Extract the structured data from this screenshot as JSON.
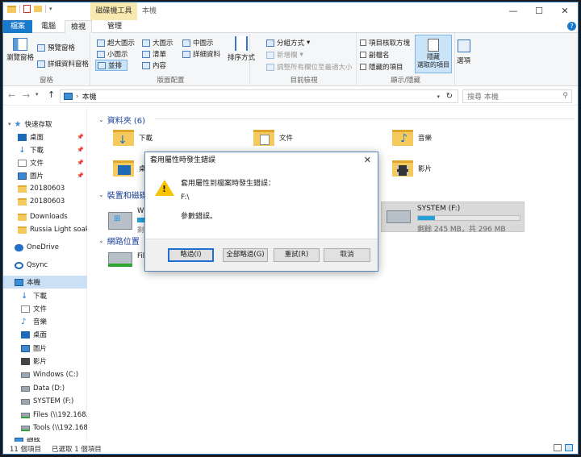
{
  "window": {
    "title": "本機",
    "context_tab_label": "磁碟機工具",
    "controls": {
      "minimize": "—",
      "maximize": "☐",
      "close": "✕"
    }
  },
  "tabs": {
    "file": "檔案",
    "computer": "電腦",
    "view": "檢視",
    "manage": "管理"
  },
  "ribbon": {
    "panes": {
      "nav_pane": "瀏覽窗格",
      "preview_pane": "預覽窗格",
      "details_pane": "詳細資料窗格",
      "label": "窗格"
    },
    "layout": {
      "xl_icons": "超大圖示",
      "large_icons": "大圖示",
      "medium_icons": "中圖示",
      "small_icons": "小圖示",
      "list": "清單",
      "details": "詳細資料",
      "tiles": "並排",
      "content": "內容",
      "label": "版面配置"
    },
    "current_view": {
      "sort_by": "排序方式",
      "group_by": "分組方式",
      "add_columns": "新增欄",
      "size_all_columns": "調整所有欄位至最適大小",
      "label": "目前檢視"
    },
    "show_hide": {
      "item_checkboxes": "項目核取方塊",
      "file_extensions": "副檔名",
      "hidden_items": "隱藏的項目",
      "hide_selected": "隱藏\n選取的項目",
      "label": "顯示/隱藏"
    },
    "options": "選項"
  },
  "address": {
    "path": "本機",
    "search_placeholder": "搜尋 本機"
  },
  "sidebar": {
    "items": [
      {
        "label": "快速存取",
        "icon": "star-icon"
      },
      {
        "label": "桌面",
        "icon": "desktop-icon",
        "pinned": true
      },
      {
        "label": "下載",
        "icon": "download-icon",
        "pinned": true
      },
      {
        "label": "文件",
        "icon": "document-icon",
        "pinned": true
      },
      {
        "label": "圖片",
        "icon": "picture-icon",
        "pinned": true
      },
      {
        "label": "20180603",
        "icon": "folder-icon"
      },
      {
        "label": "20180603",
        "icon": "folder-icon"
      },
      {
        "label": "Downloads",
        "icon": "folder-icon"
      },
      {
        "label": "Russia Light soaki",
        "icon": "folder-icon"
      },
      {
        "label": "OneDrive",
        "icon": "cloud-icon"
      },
      {
        "label": "Qsync",
        "icon": "qsync-icon"
      },
      {
        "label": "本機",
        "icon": "pc-icon"
      },
      {
        "label": "下載",
        "icon": "download-icon"
      },
      {
        "label": "文件",
        "icon": "document-icon"
      },
      {
        "label": "音樂",
        "icon": "music-icon"
      },
      {
        "label": "桌面",
        "icon": "desktop-icon"
      },
      {
        "label": "圖片",
        "icon": "picture-icon"
      },
      {
        "label": "影片",
        "icon": "video-icon"
      },
      {
        "label": "Windows (C:)",
        "icon": "drive-icon"
      },
      {
        "label": "Data (D:)",
        "icon": "drive-icon"
      },
      {
        "label": "SYSTEM (F:)",
        "icon": "drive-icon"
      },
      {
        "label": "Files (\\\\192.168.1.",
        "icon": "network-drive-icon"
      },
      {
        "label": "Tools (\\\\192.168.",
        "icon": "network-drive-icon"
      },
      {
        "label": "網路",
        "icon": "network-icon"
      }
    ]
  },
  "main": {
    "folders_header": "資料夾 (6)",
    "devices_header": "裝置和磁碟",
    "network_header": "網路位置",
    "folders": [
      {
        "label": "下載"
      },
      {
        "label": "文件"
      },
      {
        "label": "音樂"
      },
      {
        "label": "桌"
      },
      {
        "label": "影片"
      }
    ],
    "devices": {
      "windows_prefix": "Win",
      "windows_free_prefix": "剩",
      "data_free_prefix": "剩",
      "system_name": "SYSTEM (F:)",
      "system_free": "剩餘 245 MB，共 296 MB",
      "system_usage_fraction": 0.17
    },
    "network": {
      "files_prefix": "File"
    }
  },
  "status": {
    "count": "11 個項目",
    "selected": "已選取 1 個項目"
  },
  "dialog": {
    "title": "套用屬性時發生錯誤",
    "message": "套用屬性到檔案時發生錯誤：",
    "path": "F:\\",
    "detail": "參數錯誤。",
    "buttons": {
      "ignore": "略過(I)",
      "ignore_all": "全部略過(G)",
      "retry": "重試(R)",
      "cancel": "取消"
    }
  }
}
